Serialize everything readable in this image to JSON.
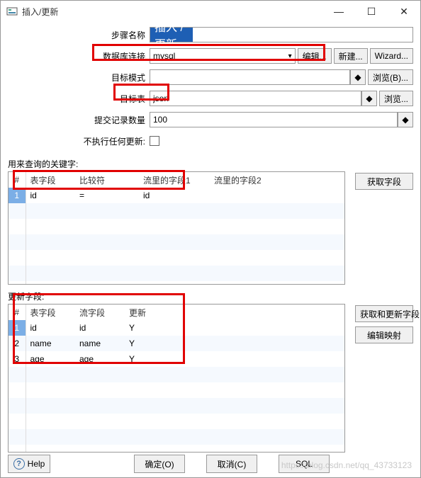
{
  "window": {
    "title": "插入/更新",
    "min": "—",
    "max": "☐",
    "close": "✕"
  },
  "form": {
    "step_label": "步骤名称",
    "step_value": "插入 / 更新",
    "conn_label": "数据库连接",
    "conn_value": "mysql",
    "schema_label": "目标模式",
    "schema_value": "",
    "table_label": "目标表",
    "table_value": "json",
    "commit_label": "提交记录数量",
    "commit_value": "100",
    "noupdate_label": "不执行任何更新:"
  },
  "buttons": {
    "edit": "编辑...",
    "new": "新建...",
    "wizard": "Wizard...",
    "browseB": "浏览(B)...",
    "browse": "浏览...",
    "getfields": "获取字段",
    "getupdate": "获取和更新字段",
    "editmap": "编辑映射",
    "ok": "确定(O)",
    "cancel": "取消(C)",
    "sql": "SQL",
    "help": "Help"
  },
  "diamond": "◆",
  "keysec_label": "用来查询的关键字:",
  "keycols": {
    "hash": "#",
    "tf": "表字段",
    "cmp": "比较符",
    "s1": "流里的字段1",
    "s2": "流里的字段2"
  },
  "keyrows": [
    {
      "n": "1",
      "tf": "id",
      "cmp": "=",
      "s1": "id",
      "s2": ""
    }
  ],
  "updsec_label": "更新字段:",
  "updcols": {
    "hash": "#",
    "tf": "表字段",
    "sf": "流字段",
    "upd": "更新"
  },
  "updrows": [
    {
      "n": "1",
      "tf": "id",
      "sf": "id",
      "upd": "Y"
    },
    {
      "n": "2",
      "tf": "name",
      "sf": "name",
      "upd": "Y"
    },
    {
      "n": "3",
      "tf": "age",
      "sf": "age",
      "upd": "Y"
    }
  ],
  "watermark": "https://blog.csdn.net/qq_43733123"
}
